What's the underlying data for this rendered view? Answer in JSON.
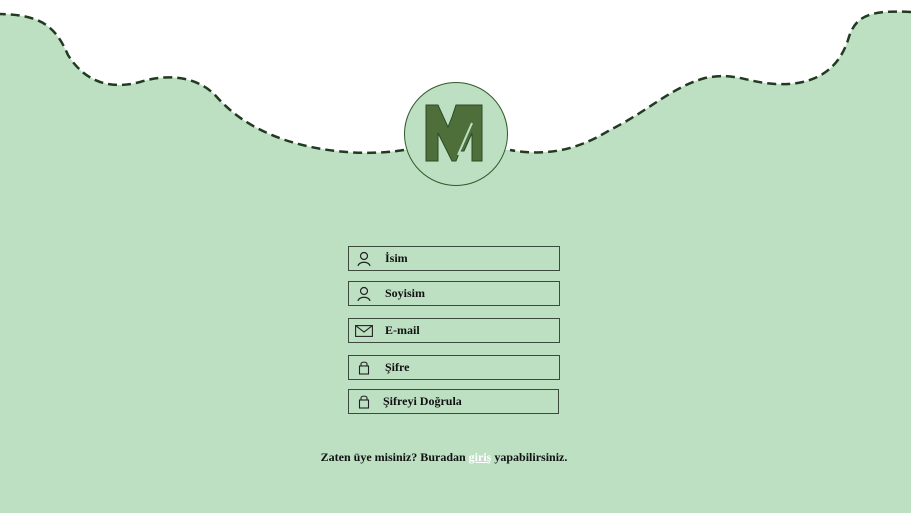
{
  "logo": {
    "letter": "M",
    "icon": "m-logo-icon",
    "color": "#4e6e3a"
  },
  "colors": {
    "background": "#bde0c3",
    "header": "#ffffff",
    "dash": "#223a20"
  },
  "form": {
    "fields": [
      {
        "icon": "user-icon",
        "placeholder": "İsim"
      },
      {
        "icon": "user-icon",
        "placeholder": "Soyisim"
      },
      {
        "icon": "mail-icon",
        "placeholder": "E-mail"
      },
      {
        "icon": "lock-icon",
        "placeholder": "Şifre"
      },
      {
        "icon": "lock-icon",
        "placeholder": "Şifreyi Doğrula"
      }
    ]
  },
  "footer": {
    "before": "Zaten üye misiniz? Buradan",
    "link": "giriş",
    "after": "yapabilirsiniz."
  }
}
